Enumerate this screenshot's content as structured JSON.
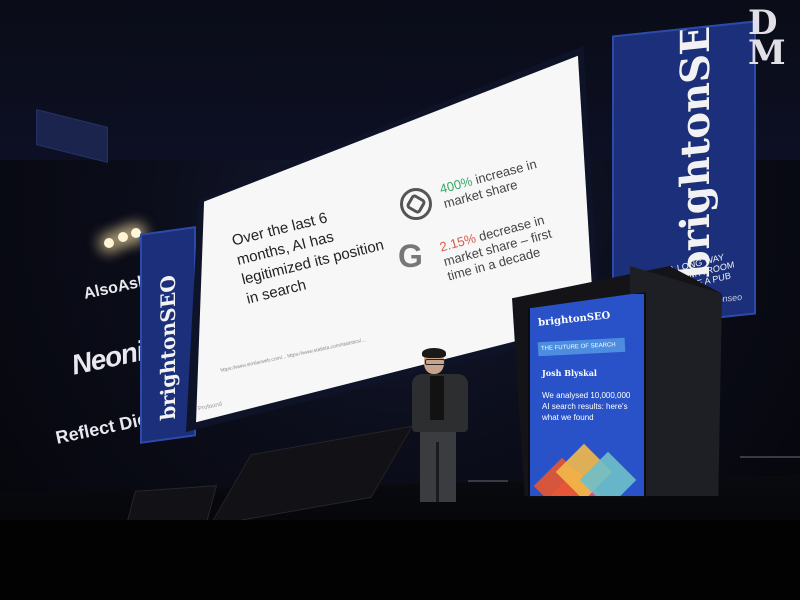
{
  "sponsors": {
    "left_wall": [
      "AlsoAsked",
      "Neonify",
      "Reflect Digital"
    ]
  },
  "banners": {
    "left": "brightonSEO",
    "right": "brightonSEO",
    "right_subtext": "A LONG WAY FROM A ROOM ABOVE A PUB",
    "right_handle": "@brightonseo",
    "corner_letters": "D\nM"
  },
  "slide": {
    "headline": "Over the last 6 months, AI has legitimized its position in search",
    "stat1_highlight": "400%",
    "stat1_text": " increase in market share",
    "stat2_highlight": "2.15%",
    "stat2_text": " decrease in market share – first time in a decade",
    "icons": [
      "openai-icon",
      "google-icon"
    ],
    "sources": "https://www.similarweb.com/... https://www.statista.com/statistics/...",
    "footer_brand": "Profound"
  },
  "podium_screen": {
    "logo": "brightonSEO",
    "bar": "THE FUTURE OF SEARCH",
    "speaker_name": "Josh Blyskal",
    "talk_title": "We analysed 10,000,000 AI search results: here's what we found"
  }
}
